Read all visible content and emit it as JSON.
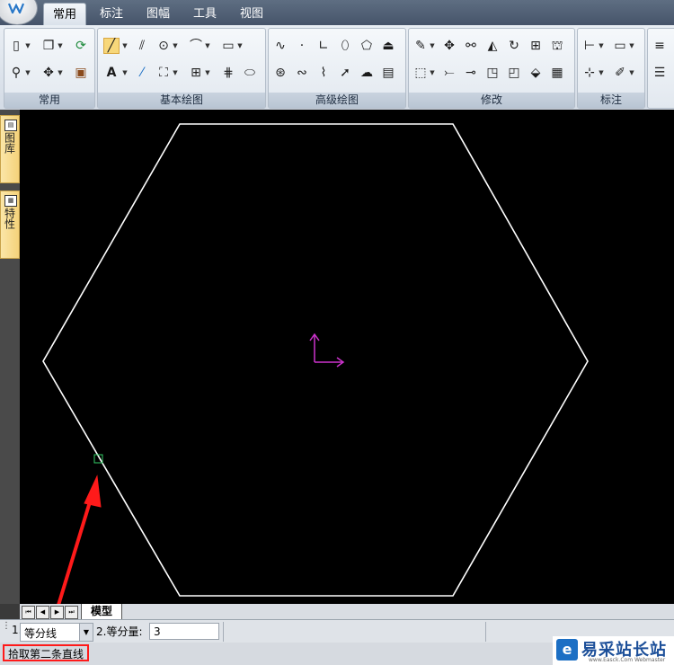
{
  "tabs": [
    {
      "label": "常用",
      "active": true
    },
    {
      "label": "标注",
      "active": false
    },
    {
      "label": "图幅",
      "active": false
    },
    {
      "label": "工具",
      "active": false
    },
    {
      "label": "视图",
      "active": false
    }
  ],
  "ribbon_groups": [
    "常用",
    "基本绘图",
    "高级绘图",
    "修改",
    "标注"
  ],
  "dock_tabs": [
    "图库",
    "特性"
  ],
  "model_tab": "模型",
  "command_bar": {
    "step1_label": "1.",
    "method_value": "等分线",
    "step2_label": "2.等分量:",
    "count_value": "3"
  },
  "status": {
    "prompt": "拾取第二条直线"
  },
  "watermark": {
    "icon": "e",
    "title": "易采站长站",
    "subtitle": "www.Easck.Com Webmaster"
  },
  "colors": {
    "highlight": "#ff1a1a",
    "ucs": "#cc33cc",
    "pick_box": "#33cc66"
  }
}
